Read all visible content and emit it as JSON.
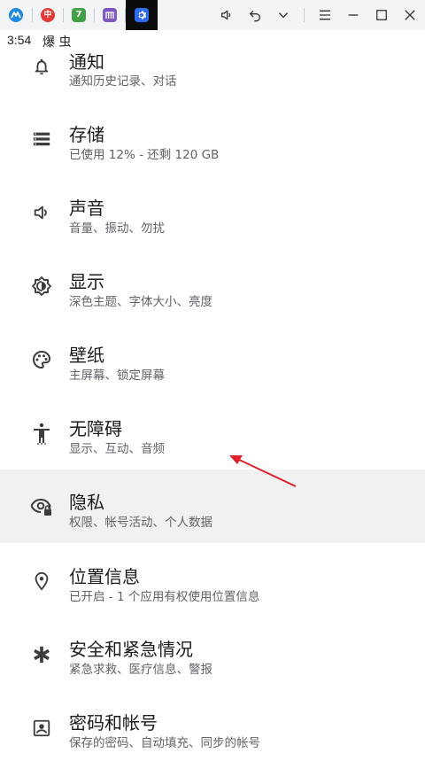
{
  "status_bar": {
    "time": "3:54",
    "icons_text": "爆 虫"
  },
  "tabs": [
    {
      "name": "tab-app-1",
      "color": "#1e88e5",
      "glyph": "M"
    },
    {
      "name": "tab-app-2",
      "color": "#e53935",
      "glyph": "中"
    },
    {
      "name": "tab-app-3",
      "color": "#43a047",
      "glyph": "7"
    },
    {
      "name": "tab-app-4",
      "color": "#7e57c2",
      "glyph": "m"
    },
    {
      "name": "tab-settings",
      "color": "#2f6cf6",
      "glyph": "⚙"
    }
  ],
  "settings": [
    {
      "title": "通知",
      "subtitle": "通知历史记录、对话",
      "icon": "bell-icon"
    },
    {
      "title": "存储",
      "subtitle": "已使用 12% - 还剩 120 GB",
      "icon": "storage-icon"
    },
    {
      "title": "声音",
      "subtitle": "音量、振动、勿扰",
      "icon": "volume-icon"
    },
    {
      "title": "显示",
      "subtitle": "深色主题、字体大小、亮度",
      "icon": "brightness-icon"
    },
    {
      "title": "壁纸",
      "subtitle": "主屏幕、锁定屏幕",
      "icon": "palette-icon"
    },
    {
      "title": "无障碍",
      "subtitle": "显示、互动、音频",
      "icon": "accessibility-icon"
    },
    {
      "title": "隐私",
      "subtitle": "权限、帐号活动、个人数据",
      "icon": "privacy-eye-icon"
    },
    {
      "title": "位置信息",
      "subtitle": "已开启 - 1 个应用有权使用位置信息",
      "icon": "location-pin-icon"
    },
    {
      "title": "安全和紧急情况",
      "subtitle": "紧急求救、医疗信息、警报",
      "icon": "emergency-asterisk-icon"
    },
    {
      "title": "密码和帐号",
      "subtitle": "保存的密码、自动填充、同步的帐号",
      "icon": "account-box-icon"
    }
  ],
  "highlighted_index": 6,
  "colors": {
    "highlight": "#f1f1f1",
    "arrow": "#e0202a",
    "icon": "#3c3c3c"
  }
}
